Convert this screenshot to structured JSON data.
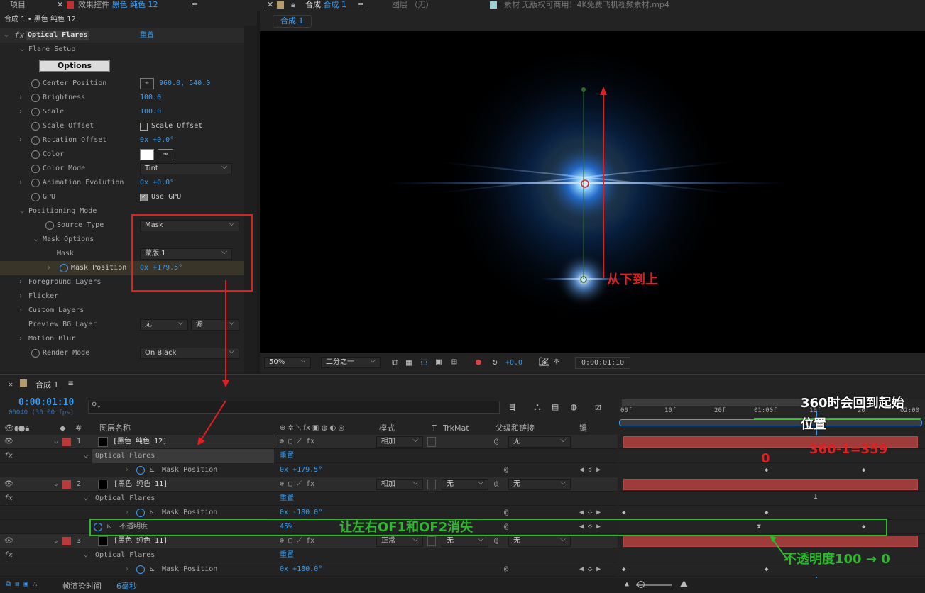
{
  "top_tabs": {
    "project": "项目",
    "effect_controls_prefix": "效果控件",
    "effect_controls_layer": "黑色 纯色 12",
    "comp_prefix": "合成",
    "comp_name": "合成 1",
    "layer_tab": "图层 （无）",
    "footage_tab": "素材 无版权可商用！4K免费飞机视频素材.mp4",
    "menu": "≡"
  },
  "effect_panel": {
    "breadcrumb": "合成 1 • 黑色 纯色 12",
    "effect_name": "Optical Flares",
    "reset": "重置",
    "flare_setup": "Flare Setup",
    "options_button": "Options",
    "props": [
      {
        "label": "Center Position",
        "value": "960.0, 540.0"
      },
      {
        "label": "Brightness",
        "value": "100.0"
      },
      {
        "label": "Scale",
        "value": "100.0"
      },
      {
        "label": "Scale Offset",
        "value": "Scale Offset"
      },
      {
        "label": "Rotation Offset",
        "value_prefix": "0x",
        "value": "+0.0°"
      },
      {
        "label": "Color",
        "value": ""
      },
      {
        "label": "Color Mode",
        "value": "Tint"
      },
      {
        "label": "Animation Evolution",
        "value_prefix": "0x",
        "value": "+0.0°"
      },
      {
        "label": "GPU",
        "value": "Use GPU"
      }
    ],
    "positioning_mode": "Positioning Mode",
    "source_type_label": "Source Type",
    "source_type_value": "Mask",
    "mask_options": "Mask Options",
    "mask_label": "Mask",
    "mask_value": "蒙版 1",
    "mask_position_label": "Mask Position",
    "mask_position_prefix": "0x",
    "mask_position_value": "+179.5°",
    "foreground_layers": "Foreground Layers",
    "flicker": "Flicker",
    "custom_layers": "Custom Layers",
    "preview_bg_label": "Preview BG Layer",
    "preview_bg_value": "无",
    "preview_bg_value2": "源",
    "motion_blur": "Motion Blur",
    "render_mode_label": "Render Mode",
    "render_mode_value": "On Black"
  },
  "viewer": {
    "comp_tab": "合成 1",
    "annotation": "从下到上"
  },
  "viewer_bar": {
    "zoom": "50%",
    "resolution": "二分之一",
    "exposure": "+0.0",
    "timecode": "0:00:01:10"
  },
  "timeline": {
    "tab": "合成 1",
    "timecode": "0:00:01:10",
    "frames": "00040 (30.00 fps)",
    "search_placeholder": "",
    "headers": {
      "layer_name": "图层名称",
      "mode": "模式",
      "t": "T",
      "trkmat": "TrkMat",
      "parent": "父级和链接",
      "keys": "键"
    },
    "ruler": [
      "00f",
      "10f",
      "20f",
      "01:00f",
      "10f",
      "20f",
      "02:00"
    ],
    "layers": [
      {
        "num": "1",
        "name": "[黑色 纯色 12]",
        "mode": "相加",
        "trkmat": "",
        "parent": "无",
        "effect": "Optical Flares",
        "reset": "重置",
        "prop": "Mask Position",
        "prefix": "0x",
        "value": "+179.5°"
      },
      {
        "num": "2",
        "name": "[黑色 纯色 11]",
        "mode": "相加",
        "trkmat": "无",
        "parent": "无",
        "effect": "Optical Flares",
        "reset": "重置",
        "prop": "Mask Position",
        "prefix": "0x",
        "value": "-180.0°",
        "opacity_label": "不透明度",
        "opacity_value": "45%"
      },
      {
        "num": "3",
        "name": "[黑色 纯色 11]",
        "mode": "正常",
        "trkmat": "无",
        "parent": "无",
        "effect": "Optical Flares",
        "reset": "重置",
        "prop": "Mask Position",
        "prefix": "0x",
        "value": "+180.0°"
      }
    ],
    "footer_label": "帧渲染时间",
    "footer_value": "6毫秒"
  },
  "annotations": {
    "a360": "360时会回到起始",
    "a360b": "位置",
    "zero": "0",
    "a359": "360-1=359",
    "green": "让左右OF1和OF2消失",
    "opacity": "不透明度100 → 0"
  },
  "colors": {
    "accent": "#3a9ef5",
    "red": "#e02020",
    "green": "#2eb82e",
    "layer_bar": "#9e3c3c"
  }
}
